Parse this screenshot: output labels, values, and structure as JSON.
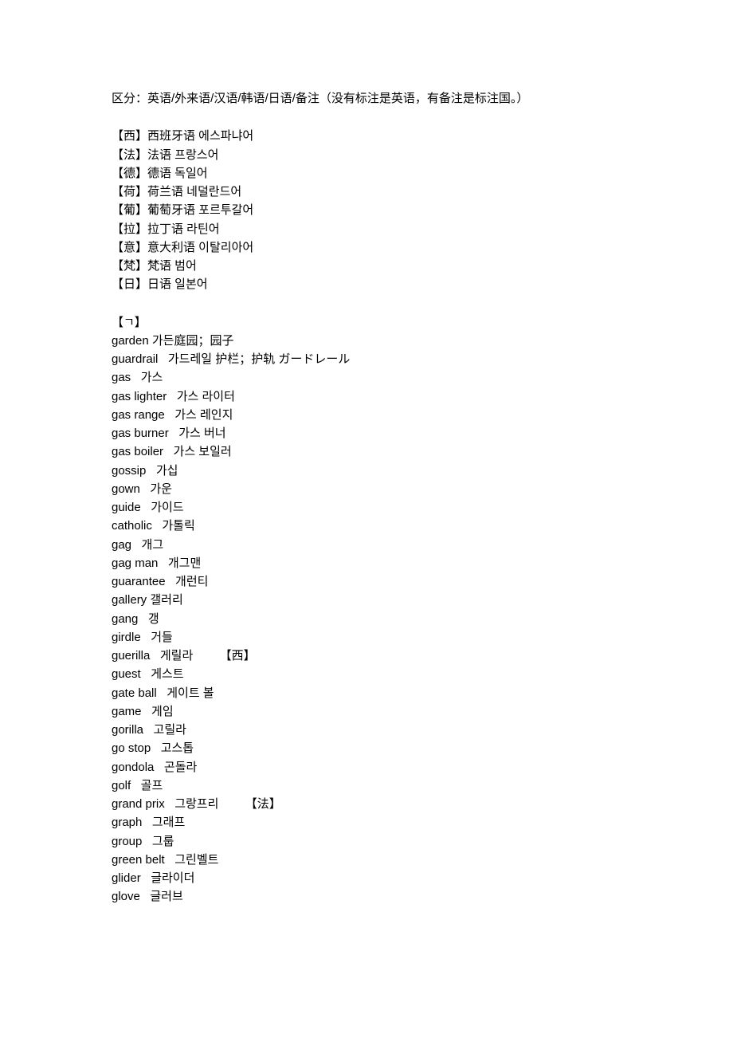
{
  "header": "区分：英语/外来语/汉语/韩语/日语/备注（没有标注是英语，有备注是标注国。）",
  "legend": [
    "【西】西班牙语 에스파냐어",
    "【法】法语 프랑스어",
    "【德】德语 독일어",
    "【荷】荷兰语 네덜란드어",
    "【葡】葡萄牙语 포르투갈어",
    "【拉】拉丁语 라틴어",
    "【意】意大利语 이탈리아어",
    "【梵】梵语 범어",
    "【日】日语 일본어"
  ],
  "section": "【ㄱ】",
  "entries": [
    "garden 가든庭园；园子",
    "guardrail   가드레일 护栏；护轨 ガードレール",
    "gas   가스",
    "gas lighter   가스 라이터",
    "gas range   가스 레인지",
    "gas burner   가스 버너",
    "gas boiler   가스 보일러",
    "gossip   가십",
    "gown   가운",
    "guide   가이드",
    "catholic   가톨릭",
    "gag   개그",
    "gag man   개그맨",
    "guarantee   개런티",
    "gallery 갤러리",
    "gang   갱",
    "girdle   거들",
    "guerilla   게릴라        【西】",
    "guest   게스트",
    "gate ball   게이트 볼",
    "game   게임",
    "gorilla   고릴라",
    "go stop   고스톱",
    "gondola   곤돌라",
    "golf   골프",
    "grand prix   그랑프리        【法】",
    "graph   그래프",
    "group   그룹",
    "green belt   그린벨트",
    "glider   글라이더",
    "glove   글러브"
  ]
}
